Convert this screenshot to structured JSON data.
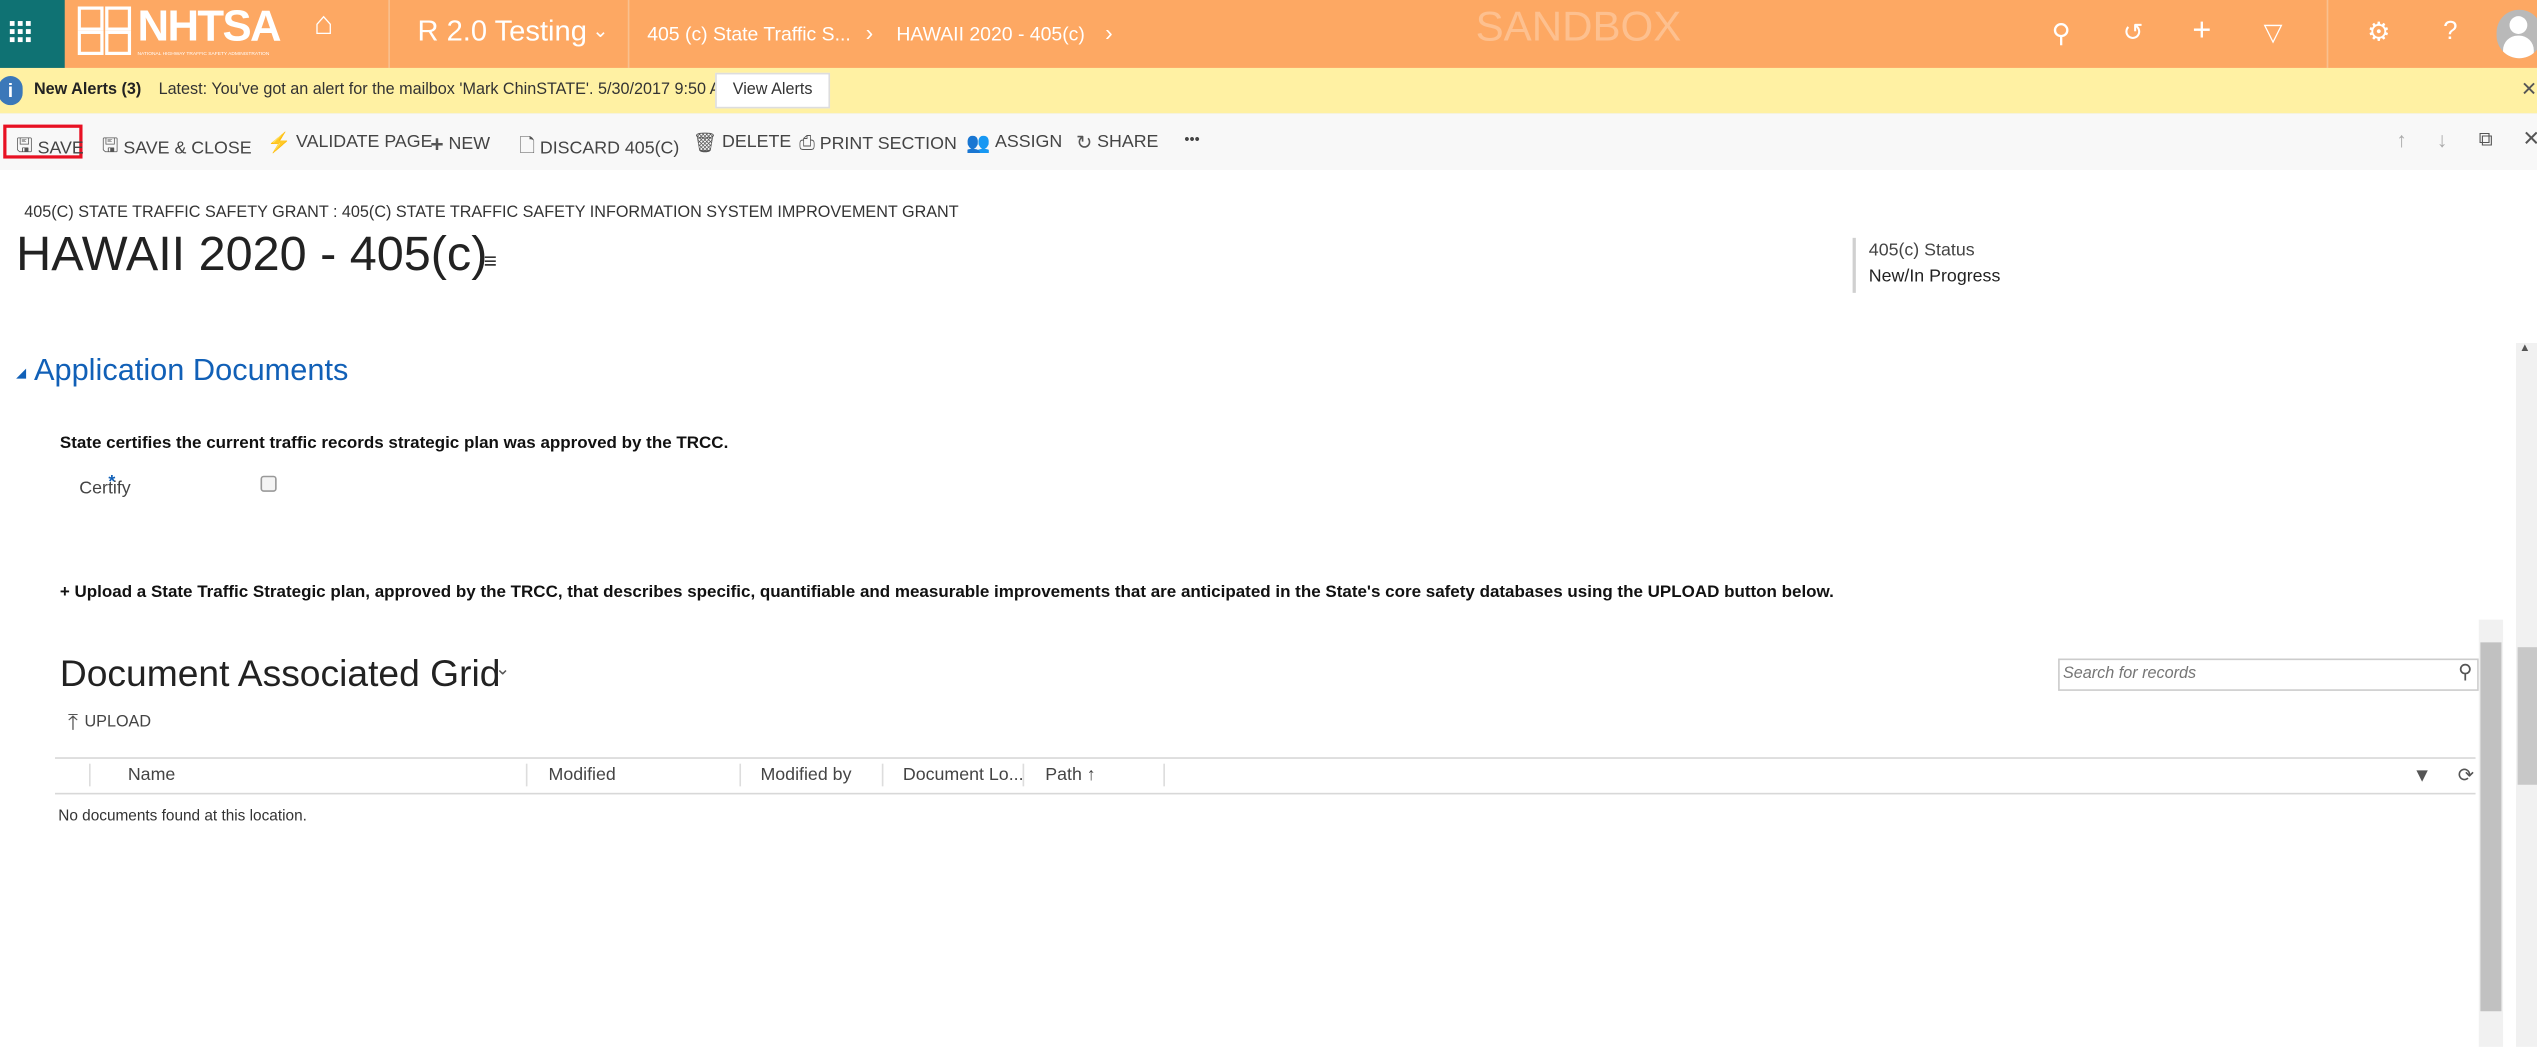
{
  "header": {
    "logo_text": "NHTSA",
    "logo_subtext": "NATIONAL HIGHWAY TRAFFIC SAFETY ADMINISTRATION",
    "app_name": "R 2.0 Testing",
    "breadcrumb": [
      "405 (c) State Traffic S...",
      "HAWAII 2020 - 405(c)"
    ],
    "environment": "SANDBOX",
    "icons": [
      "search-icon",
      "history-icon",
      "plus-icon",
      "filter-icon",
      "gear-icon",
      "help-icon",
      "avatar-icon"
    ],
    "colors": {
      "bar": "#fda863",
      "waffle": "#0f7273"
    }
  },
  "alert": {
    "title": "New Alerts (3)",
    "message": "Latest: You've got an alert for the mailbox 'Mark ChinSTATE'. 5/30/2017 9:50 AM",
    "button": "View Alerts",
    "close": "✕"
  },
  "toolbar": {
    "items": [
      {
        "label": "SAVE",
        "icon": "save-icon"
      },
      {
        "label": "SAVE & CLOSE",
        "icon": "save-close-icon"
      },
      {
        "label": "VALIDATE PAGE",
        "icon": "validate-icon"
      },
      {
        "label": "NEW",
        "icon": "plus-icon"
      },
      {
        "label": "DISCARD 405(C)",
        "icon": "discard-icon"
      },
      {
        "label": "DELETE",
        "icon": "trash-icon"
      },
      {
        "label": "PRINT SECTION",
        "icon": "print-icon"
      },
      {
        "label": "ASSIGN",
        "icon": "assign-icon"
      },
      {
        "label": "SHARE",
        "icon": "share-icon"
      }
    ],
    "more": "•••",
    "highlighted": "SAVE"
  },
  "record": {
    "breadcrumb": "405(C) STATE TRAFFIC SAFETY GRANT : 405(C) STATE TRAFFIC SAFETY INFORMATION SYSTEM IMPROVEMENT GRANT",
    "title": "HAWAII 2020 - 405(c)",
    "status_label": "405(c) Status",
    "status_value": "New/In Progress"
  },
  "section": {
    "title": "Application Documents",
    "certify_statement": "State certifies the current traffic records strategic plan was approved by the TRCC.",
    "certify_label": "Certify",
    "required_mark": "*",
    "certify_checked": false,
    "upload_instruction": "+ Upload a State Traffic Strategic plan, approved by the TRCC, that describes specific, quantifiable and measurable improvements that are anticipated in the State's core safety databases using the UPLOAD button below."
  },
  "grid": {
    "title": "Document Associated Grid",
    "search_placeholder": "Search for records",
    "upload_label": "UPLOAD",
    "columns": [
      "Name",
      "Modified",
      "Modified by",
      "Document Lo...",
      "Path ↑"
    ],
    "empty_message": "No documents found at this location."
  },
  "colors": {
    "accent_blue": "#1160b7",
    "highlight_red": "#e81123"
  }
}
